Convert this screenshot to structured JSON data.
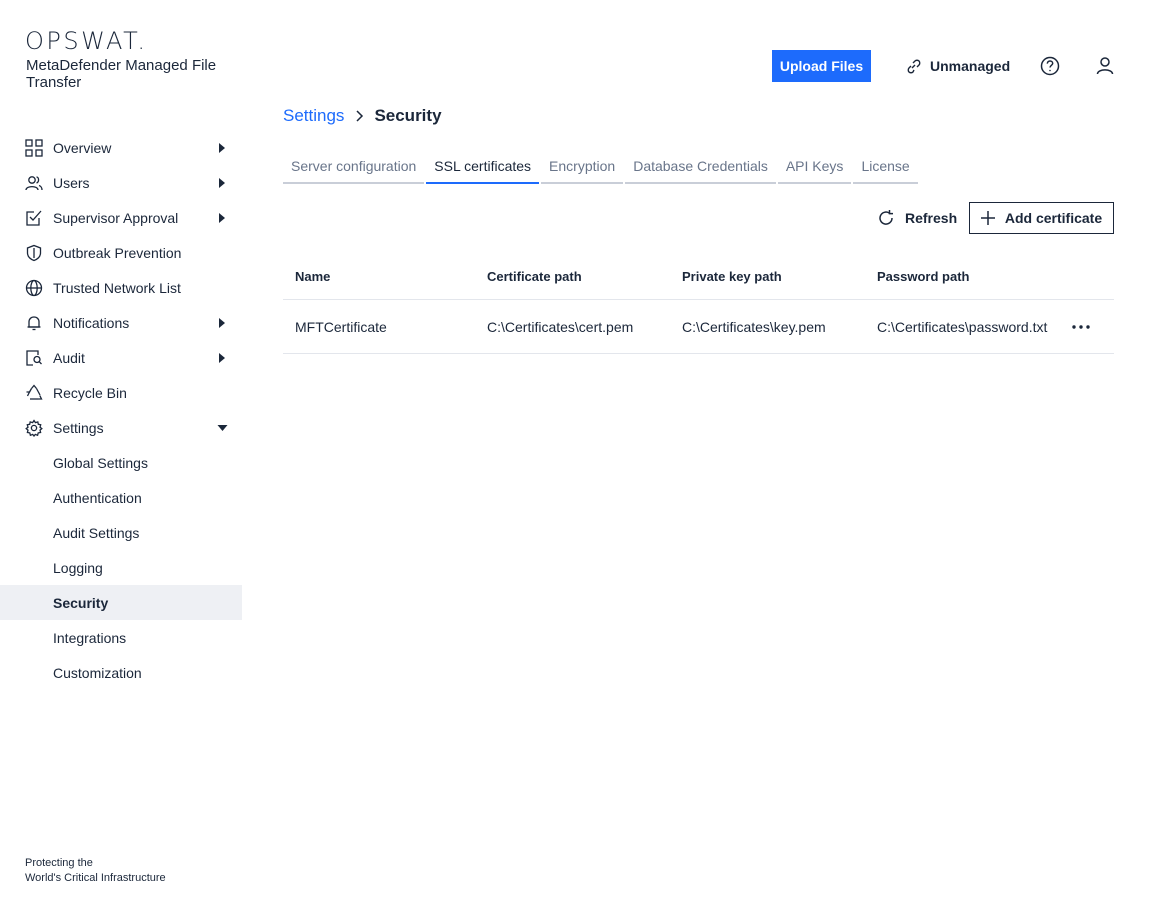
{
  "brand": {
    "logo": "OPSWAT.",
    "product": "MetaDefender Managed File Transfer",
    "tagline_line1": "Protecting the",
    "tagline_line2": "World's Critical Infrastructure"
  },
  "header": {
    "upload_label": "Upload Files",
    "status_label": "Unmanaged",
    "accent_color": "#1d6bfc"
  },
  "sidebar": {
    "items": [
      {
        "label": "Overview",
        "icon": "grid-icon",
        "expandable": true
      },
      {
        "label": "Users",
        "icon": "users-icon",
        "expandable": true
      },
      {
        "label": "Supervisor Approval",
        "icon": "approval-icon",
        "expandable": true
      },
      {
        "label": "Outbreak Prevention",
        "icon": "shield-icon",
        "expandable": false
      },
      {
        "label": "Trusted Network List",
        "icon": "globe-icon",
        "expandable": false
      },
      {
        "label": "Notifications",
        "icon": "bell-icon",
        "expandable": true
      },
      {
        "label": "Audit",
        "icon": "audit-icon",
        "expandable": true
      },
      {
        "label": "Recycle Bin",
        "icon": "recycle-icon",
        "expandable": false
      },
      {
        "label": "Settings",
        "icon": "gear-icon",
        "expandable": true,
        "expanded": true
      }
    ],
    "settings_children": [
      {
        "label": "Global Settings"
      },
      {
        "label": "Authentication"
      },
      {
        "label": "Audit Settings"
      },
      {
        "label": "Logging"
      },
      {
        "label": "Security",
        "active": true
      },
      {
        "label": "Integrations"
      },
      {
        "label": "Customization"
      }
    ]
  },
  "breadcrumb": {
    "parent": "Settings",
    "current": "Security"
  },
  "tabs": [
    {
      "label": "Server configuration"
    },
    {
      "label": "SSL certificates",
      "active": true
    },
    {
      "label": "Encryption"
    },
    {
      "label": "Database Credentials"
    },
    {
      "label": "API Keys"
    },
    {
      "label": "License"
    }
  ],
  "toolbar": {
    "refresh_label": "Refresh",
    "add_label": "Add certificate"
  },
  "table": {
    "columns": [
      "Name",
      "Certificate path",
      "Private key path",
      "Password path"
    ],
    "rows": [
      [
        "MFTCertificate",
        "C:\\Certificates\\cert.pem",
        "C:\\Certificates\\key.pem",
        "C:\\Certificates\\password.txt"
      ]
    ]
  }
}
